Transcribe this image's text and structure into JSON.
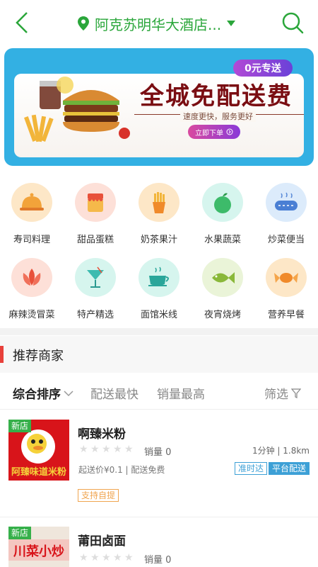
{
  "header": {
    "location": "阿克苏明华大酒店...",
    "icons": {
      "back": "back-chevron-icon",
      "location": "location-pin-icon",
      "dropdown": "caret-down-icon",
      "search": "search-icon"
    }
  },
  "banner": {
    "tag": "0元专送",
    "title": "全城免配送费",
    "subtitle": "速度更快，服务更好",
    "button": "立即下单"
  },
  "categories": [
    {
      "label": "寿司料理",
      "icon": "cloche-icon",
      "bg": "#fde7c7"
    },
    {
      "label": "甜品蛋糕",
      "icon": "dessert-jar-icon",
      "bg": "#fde0d8"
    },
    {
      "label": "奶茶果汁",
      "icon": "fries-drink-icon",
      "bg": "#fde7c7"
    },
    {
      "label": "水果蔬菜",
      "icon": "apple-icon",
      "bg": "#d6f5ee"
    },
    {
      "label": "炒菜便当",
      "icon": "sausage-icon",
      "bg": "#dcebfb"
    },
    {
      "label": "麻辣烫冒菜",
      "icon": "lotus-icon",
      "bg": "#fde0d8"
    },
    {
      "label": "特产精选",
      "icon": "cocktail-icon",
      "bg": "#d6f5ee"
    },
    {
      "label": "面馆米线",
      "icon": "steaming-bowl-icon",
      "bg": "#d6f5ee"
    },
    {
      "label": "夜宵烧烤",
      "icon": "fish-icon",
      "bg": "#eaf4d8"
    },
    {
      "label": "营养早餐",
      "icon": "candy-icon",
      "bg": "#fde7c7"
    }
  ],
  "section": {
    "title": "推荐商家"
  },
  "sort": {
    "comprehensive": "综合排序",
    "fastest": "配送最快",
    "sales": "销量最高",
    "filter": "筛选"
  },
  "merchants": [
    {
      "new_tag": "新店",
      "name": "啊臻米粉",
      "rating": 0,
      "sales": "销量 0",
      "distance": "1分钟 | 1.8km",
      "min_order": "起送价¥0.1 | 配送免费",
      "badge_ontime": "准时达",
      "badge_platform": "平台配送",
      "badge_pickup": "支持自提",
      "sign_text": "阿臻味道米粉"
    },
    {
      "new_tag": "新店",
      "name": "莆田卤面",
      "rating": 0,
      "sales": "销量 0",
      "sign_text": "川菜小炒"
    }
  ]
}
